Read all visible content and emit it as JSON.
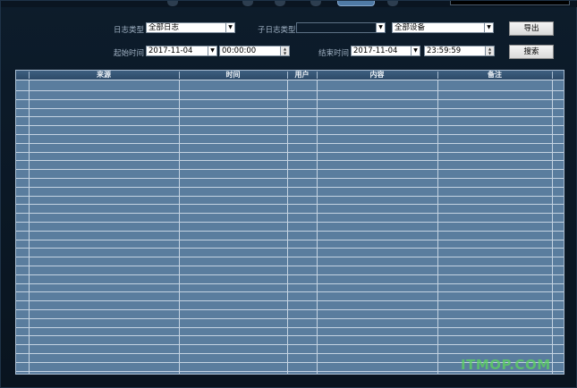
{
  "filters": {
    "log_type_label": "日志类型",
    "log_type_value": "全部日志",
    "sub_log_type_label": "子日志类型",
    "sub_log_type_value": "",
    "device_value": "全部设备",
    "start_time_label": "起始时间",
    "start_date": "2017-11-04",
    "start_time": "00:00:00",
    "end_time_label": "结束时间",
    "end_date": "2017-11-04",
    "end_time": "23:59:59"
  },
  "buttons": {
    "export_label": "导出",
    "search_label": "搜索"
  },
  "table": {
    "columns": [
      "来源",
      "时间",
      "用户",
      "内容",
      "备注"
    ],
    "row_count": 0
  },
  "watermark": "ITMOP.COM"
}
